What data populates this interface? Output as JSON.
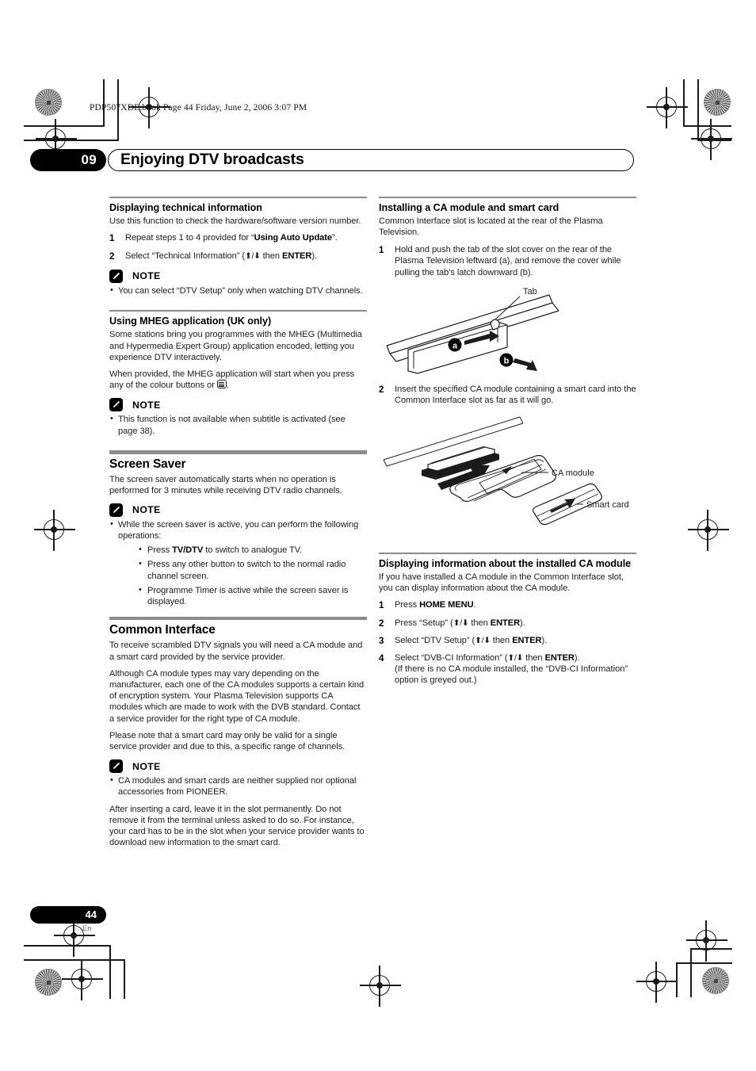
{
  "header": {
    "filestamp": "PDP507XDE.book  Page 44  Friday, June 2, 2006  3:07 PM",
    "chapter_number": "09",
    "chapter_title": "Enjoying DTV broadcasts"
  },
  "footer": {
    "page_number": "44",
    "language_code": "En"
  },
  "note_label": "NOTE",
  "left_column": {
    "section_1": {
      "heading": "Displaying technical information",
      "intro": "Use this function to check the hardware/software version number.",
      "steps": [
        {
          "num": "1",
          "text_before": "Repeat steps 1 to 4 provided for “",
          "bold": "Using Auto Update",
          "text_after": "”."
        },
        {
          "num": "2",
          "text_before": "Select “Technical Information” (",
          "arrows": "⬆/⬇",
          "mid": " then ",
          "bold": "ENTER",
          "text_after": ")."
        }
      ],
      "note_bullets": [
        "You can select “DTV Setup” only when watching DTV channels."
      ]
    },
    "section_2": {
      "heading": "Using MHEG application (UK only)",
      "paragraph_1": "Some stations bring you programmes with the MHEG (Multimedia and Hypermedia Expert Group) application encoded, letting you experience DTV interactively.",
      "paragraph_2_before": "When provided, the MHEG application will start when you press any of the colour buttons or ",
      "paragraph_2_after": ".",
      "note_bullets": [
        "This function is not available when subtitle is activated (see page 38)."
      ]
    },
    "section_3": {
      "heading": "Screen Saver",
      "intro": "The screen saver automatically starts when no operation is performed for 3 minutes while receiving DTV radio channels.",
      "note_bullet_intro": "While the screen saver is active, you can perform the following operations:",
      "note_sub_bullets": [
        {
          "text_before": "Press ",
          "bold": "TV/DTV",
          "text_after": " to switch to analogue TV."
        },
        {
          "text_before": "Press any other button to switch to the normal radio channel screen.",
          "bold": "",
          "text_after": ""
        },
        {
          "text_before": "Programme Timer is active while the screen saver is displayed.",
          "bold": "",
          "text_after": ""
        }
      ]
    },
    "section_4": {
      "heading": "Common Interface",
      "paragraph_1": "To receive scrambled DTV signals you will need a CA module and a smart card provided by the service provider.",
      "paragraph_2": "Although CA module types may vary depending on the manufacturer, each one of the CA modules supports a certain kind of encryption system. Your Plasma Television supports CA modules which are made to work with the DVB standard. Contact a service provider for the right type of CA module.",
      "paragraph_3": "Please note that a smart card may only be valid for a single service provider and due to this, a specific range of channels.",
      "note_bullets": [
        "CA modules and smart cards are neither supplied nor optional accessories from PIONEER."
      ],
      "paragraph_4": "After inserting a card, leave it in the slot permanently. Do not remove it from the terminal unless asked to do so. For instance, your card has to be in the slot when your service provider wants to download new information to the smart card."
    }
  },
  "right_column": {
    "section_1": {
      "heading": "Installing a CA module and smart card",
      "intro": "Common Interface slot is located at the rear of the Plasma Television.",
      "step_1": {
        "num": "1",
        "text": "Hold and push the tab of the slot cover on the rear of the Plasma Television leftward (a), and remove the cover while pulling the tab’s latch downward (b)."
      },
      "figure_1": {
        "label_tab": "Tab",
        "callout_a": "a",
        "callout_b": "b"
      },
      "step_2": {
        "num": "2",
        "text": "Insert the specified CA module containing a smart card into the Common Interface slot as far as it will go."
      },
      "figure_2": {
        "label_ca_module": "CA module",
        "label_smart_card": "Smart card"
      }
    },
    "section_2": {
      "heading": "Displaying information about the installed CA module",
      "intro": "If you have installed a CA module in the Common Interface slot, you can display information about the CA module.",
      "steps": [
        {
          "num": "1",
          "text_before": "Press ",
          "bold": "HOME MENU",
          "arrows": "",
          "mid": "",
          "text_after": "."
        },
        {
          "num": "2",
          "text_before": "Press “Setup” (",
          "arrows": "⬆/⬇",
          "mid": " then ",
          "bold": "ENTER",
          "text_after": ")."
        },
        {
          "num": "3",
          "text_before": "Select “DTV Setup” (",
          "arrows": "⬆/⬇",
          "mid": " then ",
          "bold": "ENTER",
          "text_after": ")."
        },
        {
          "num": "4",
          "text_before": "Select “DVB-CI Information” (",
          "arrows": "⬆/⬇",
          "mid": " then ",
          "bold": "ENTER",
          "text_after": ")."
        }
      ],
      "step_4_note": "(If there is no CA module installed, the “DVB-CI Information” option is greyed out.)"
    }
  }
}
